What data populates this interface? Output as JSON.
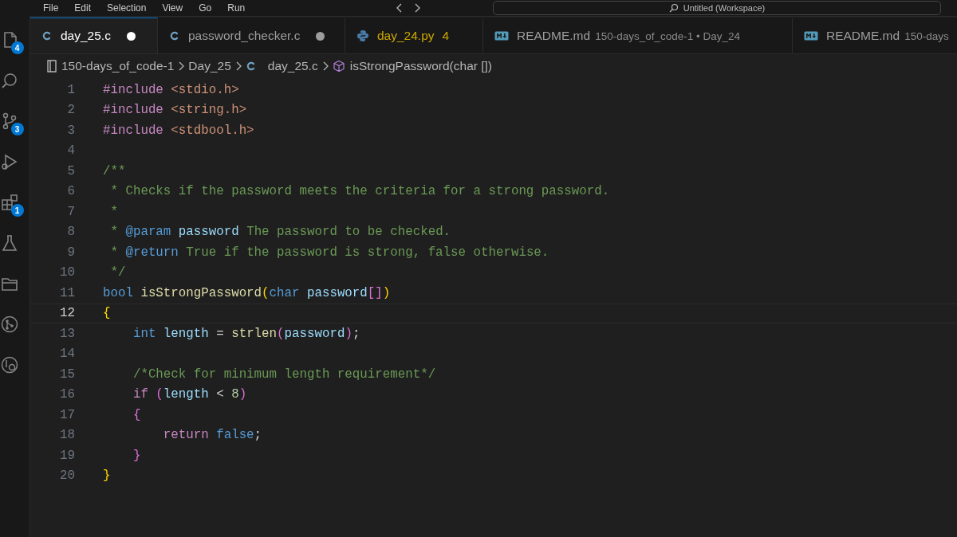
{
  "menu_bar": {
    "items": [
      "File",
      "Edit",
      "Selection",
      "View",
      "Go",
      "Run"
    ],
    "command_center": "Untitled (Workspace)"
  },
  "activity_bar": [
    {
      "kind": "explorer",
      "badge": "4"
    },
    {
      "kind": "search"
    },
    {
      "kind": "source-control",
      "badge": "3"
    },
    {
      "kind": "run"
    },
    {
      "kind": "extensions",
      "badge": "1"
    },
    {
      "kind": "testing"
    },
    {
      "kind": "folder"
    },
    {
      "kind": "git-graph"
    },
    {
      "kind": "remote"
    }
  ],
  "tabs": [
    {
      "kind": "c",
      "label": "day_25.c",
      "selected": true,
      "modified": true
    },
    {
      "kind": "c",
      "label": "password_checker.c",
      "selected": false,
      "modified": true
    },
    {
      "kind": "python",
      "label": "day_24.py",
      "problems": "4",
      "selected": false,
      "modified": false
    },
    {
      "kind": "markdown",
      "label": "README.md",
      "description": "150-days_of_code-1 • Day_24",
      "selected": false,
      "modified": false
    },
    {
      "kind": "markdown",
      "label": "README.md",
      "description": "150-days",
      "selected": false,
      "modified": false
    }
  ],
  "breadcrumb": [
    {
      "kind": "folder",
      "label": "150-days_of_code-1"
    },
    {
      "kind": "folder",
      "label": "Day_25"
    },
    {
      "kind": "c-file",
      "label": "day_25.c"
    },
    {
      "kind": "symbol",
      "label": "isStrongPassword(char [])"
    }
  ],
  "editor": {
    "lines": [
      {
        "number": "1",
        "current": false,
        "tokens": [
          {
            "text": "#include",
            "kind": "kw"
          },
          {
            "text": " <stdio.h>",
            "kind": "str"
          }
        ]
      },
      {
        "number": "2",
        "current": false,
        "tokens": [
          {
            "text": "#include",
            "kind": "kw"
          },
          {
            "text": " <string.h>",
            "kind": "str"
          }
        ]
      },
      {
        "number": "3",
        "current": false,
        "tokens": [
          {
            "text": "#include",
            "kind": "kw"
          },
          {
            "text": " <stdbool.h>",
            "kind": "str"
          }
        ]
      },
      {
        "number": "4",
        "current": false
      },
      {
        "number": "5",
        "current": false,
        "tokens": [
          {
            "text": "/**",
            "kind": "com"
          }
        ]
      },
      {
        "number": "6",
        "current": false,
        "tokens": [
          {
            "text": " * Checks if the password meets the criteria for a strong password.",
            "kind": "com"
          }
        ]
      },
      {
        "number": "7",
        "current": false,
        "tokens": [
          {
            "text": " *",
            "kind": "com"
          }
        ]
      },
      {
        "number": "8",
        "current": false,
        "tokens": [
          {
            "text": " * ",
            "kind": "com"
          },
          {
            "text": "@param",
            "kind": "tag"
          },
          {
            "text": " password",
            "kind": "var"
          },
          {
            "text": " The password to be checked.",
            "kind": "com"
          }
        ]
      },
      {
        "number": "9",
        "current": false,
        "tokens": [
          {
            "text": " * ",
            "kind": "com"
          },
          {
            "text": "@return",
            "kind": "tag"
          },
          {
            "text": " True if the password is strong, false otherwise.",
            "kind": "com"
          }
        ]
      },
      {
        "number": "10",
        "current": false,
        "tokens": [
          {
            "text": " */",
            "kind": "com"
          }
        ]
      },
      {
        "number": "11",
        "current": false,
        "tokens": [
          {
            "text": "bool",
            "kind": "type"
          },
          {
            "text": " isStrongPassword",
            "kind": "fn"
          },
          {
            "text": "(",
            "kind": "b1"
          },
          {
            "text": "char",
            "kind": "type"
          },
          {
            "text": " password",
            "kind": "var"
          },
          {
            "text": "[]",
            "kind": "b2"
          },
          {
            "text": ")",
            "kind": "b1"
          }
        ]
      },
      {
        "number": "12",
        "current": true,
        "tokens": [
          {
            "text": "{",
            "kind": "b1"
          }
        ]
      },
      {
        "number": "13",
        "current": false,
        "tokens": [
          {
            "text": "    int",
            "kind": "type"
          },
          {
            "text": " length",
            "kind": "var"
          },
          {
            "text": " = ",
            "kind": "pl"
          },
          {
            "text": "strlen",
            "kind": "fn"
          },
          {
            "text": "(",
            "kind": "b2"
          },
          {
            "text": "password",
            "kind": "var"
          },
          {
            "text": ")",
            "kind": "b2"
          },
          {
            "text": ";",
            "kind": "pl"
          }
        ]
      },
      {
        "number": "14",
        "current": false
      },
      {
        "number": "15",
        "current": false,
        "tokens": [
          {
            "text": "    /*Check for minimum length requirement*/",
            "kind": "com"
          }
        ]
      },
      {
        "number": "16",
        "current": false,
        "tokens": [
          {
            "text": "    if",
            "kind": "kw"
          },
          {
            "text": " (",
            "kind": "b2"
          },
          {
            "text": "length",
            "kind": "var"
          },
          {
            "text": " < ",
            "kind": "pl"
          },
          {
            "text": "8",
            "kind": "num"
          },
          {
            "text": ")",
            "kind": "b2"
          }
        ]
      },
      {
        "number": "17",
        "current": false,
        "tokens": [
          {
            "text": "    {",
            "kind": "b2"
          }
        ]
      },
      {
        "number": "18",
        "current": false,
        "tokens": [
          {
            "text": "        return",
            "kind": "kw"
          },
          {
            "text": " false",
            "kind": "type"
          },
          {
            "text": ";",
            "kind": "pl"
          }
        ]
      },
      {
        "number": "19",
        "current": false,
        "tokens": [
          {
            "text": "    }",
            "kind": "b2"
          }
        ]
      },
      {
        "number": "20",
        "current": false,
        "tokens": [
          {
            "text": "}",
            "kind": "b1"
          }
        ]
      }
    ]
  }
}
